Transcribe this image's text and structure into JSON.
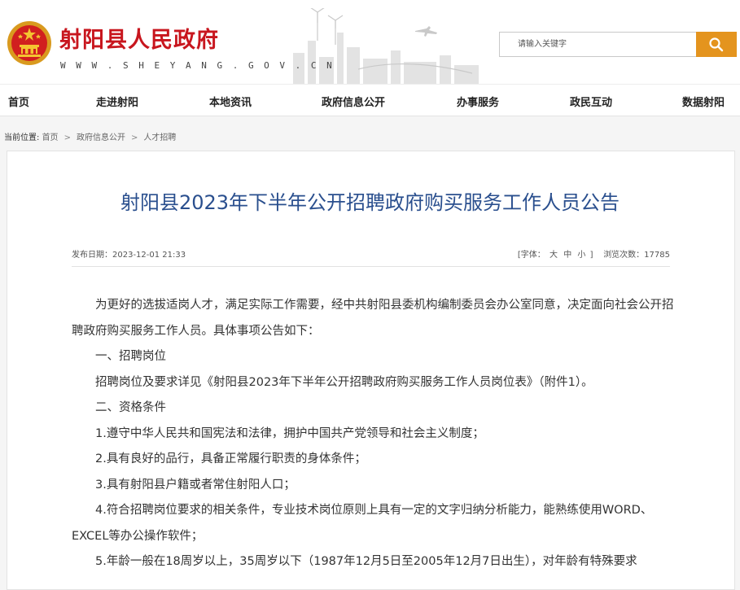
{
  "site": {
    "title": "射阳县人民政府",
    "url": "W W W . S H E Y A N G . G O V . C N"
  },
  "search": {
    "placeholder": "请输入关键字"
  },
  "nav": {
    "items": [
      {
        "label": "首页"
      },
      {
        "label": "走进射阳"
      },
      {
        "label": "本地资讯"
      },
      {
        "label": "政府信息公开"
      },
      {
        "label": "办事服务"
      },
      {
        "label": "政民互动"
      },
      {
        "label": "数据射阳"
      }
    ]
  },
  "breadcrumb": {
    "label": "当前位置:",
    "items": [
      "首页",
      "政府信息公开",
      "人才招聘"
    ],
    "separator": ">"
  },
  "article": {
    "title": "射阳县2023年下半年公开招聘政府购买服务工作人员公告",
    "publish": "发布日期：2023-12-01 21:33",
    "font_label": "[字体：",
    "font_large": "大",
    "font_medium": "中",
    "font_small": "小",
    "font_close": "]",
    "views": "浏览次数：17785",
    "paragraphs": [
      "为更好的选拔适岗人才，满足实际工作需要，经中共射阳县委机构编制委员会办公室同意，决定面向社会公开招聘政府购买服务工作人员。具体事项公告如下：",
      "一、招聘岗位",
      "招聘岗位及要求详见《射阳县2023年下半年公开招聘政府购买服务工作人员岗位表》（附件1）。",
      "二、资格条件",
      "1.遵守中华人民共和国宪法和法律，拥护中国共产党领导和社会主义制度；",
      "2.具有良好的品行，具备正常履行职责的身体条件；",
      "3.具有射阳县户籍或者常住射阳人口；",
      "4.符合招聘岗位要求的相关条件，专业技术岗位原则上具有一定的文字归纳分析能力，能熟练使用WORD、EXCEL等办公操作软件；",
      "5.年龄一般在18周岁以上，35周岁以下（1987年12月5日至2005年12月7日出生），对年龄有特殊要求"
    ]
  },
  "colors": {
    "brand_red": "#c8161e",
    "title_blue": "#2a4f8e",
    "search_orange": "#e4941e"
  }
}
